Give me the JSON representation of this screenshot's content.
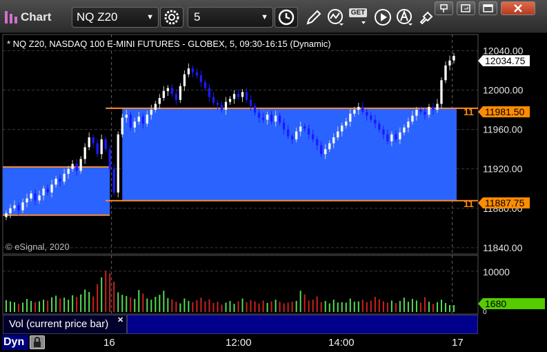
{
  "app": {
    "window_title": "Chart"
  },
  "toolbar": {
    "symbol_value": "NQ Z20",
    "interval_value": "5",
    "get_label": "GET"
  },
  "chart": {
    "header_text": "* NQ Z20, NASDAQ 100 E-MINI FUTURES - GLOBEX, 5, 09:30-16:15 (Dynamic)",
    "copyright": "© eSignal, 2020",
    "price_axis_labels": [
      "12040.00",
      "12000.00",
      "11960.00",
      "11920.00",
      "11880.00",
      "11840.00"
    ],
    "last_price_tag": "12034.75",
    "level_high_tag": "11981.50",
    "level_low_tag": "11887.75",
    "level_high_clip": "11",
    "level_low_clip": "11",
    "colors": {
      "up": "#ffffff",
      "down": "#1a1aff",
      "band": "#2b63ff",
      "level_line": "#ff8c2a",
      "level_tag": "#ff8c00",
      "vol_up": "#55dd55",
      "vol_down": "#cc2222",
      "vol_tag": "#55cc00"
    }
  },
  "volume": {
    "label": "Vol (current price bar)",
    "axis_top_label": "10000",
    "axis_zero_label": "0",
    "last_value_tag": "1680"
  },
  "time_axis": {
    "labels": [
      "16",
      "12:00",
      "14:00",
      "17"
    ]
  },
  "status": {
    "mode_label": "Dyn"
  },
  "chart_data": {
    "type": "candlestick",
    "title": "* NQ Z20, NASDAQ 100 E-MINI FUTURES - GLOBEX, 5, 09:30-16:15 (Dynamic)",
    "ylim": [
      11835,
      12055
    ],
    "levels": [
      11981.5,
      11887.75
    ],
    "last": 12034.75,
    "x": [
      "16",
      "12:00",
      "14:00",
      "17"
    ],
    "values": [
      11875,
      11880,
      11883,
      11878,
      11886,
      11890,
      11895,
      11888,
      11893,
      11900,
      11896,
      11904,
      11910,
      11907,
      11915,
      11920,
      11925,
      11918,
      11930,
      11942,
      11952,
      11946,
      11935,
      11950,
      11940,
      11920,
      11896,
      11955,
      11972,
      11975,
      11962,
      11968,
      11973,
      11966,
      11975,
      11980,
      11986,
      11992,
      11999,
      12002,
      11996,
      11990,
      12004,
      12016,
      12022,
      12018,
      12015,
      12008,
      12002,
      11993,
      11987,
      11985,
      11980,
      11988,
      11991,
      11996,
      11993,
      11998,
      11990,
      11984,
      11977,
      11972,
      11970,
      11975,
      11968,
      11974,
      11967,
      11960,
      11953,
      11950,
      11958,
      11963,
      11961,
      11955,
      11950,
      11944,
      11935,
      11940,
      11946,
      11952,
      11958,
      11964,
      11968,
      11976,
      11980,
      11983,
      11978,
      11974,
      11970,
      11966,
      11960,
      11955,
      11948,
      11955,
      11950,
      11957,
      11962,
      11968,
      11974,
      11980,
      11978,
      11975,
      11983,
      11980,
      11986,
      12010,
      12025,
      12030,
      12034.75
    ],
    "volume": [
      2900,
      2600,
      2400,
      2000,
      2300,
      3200,
      2700,
      2400,
      2600,
      3000,
      2800,
      3600,
      4000,
      3300,
      3500,
      3000,
      4100,
      3700,
      4300,
      5500,
      4900,
      3800,
      6800,
      8500,
      10100,
      9500,
      7400,
      4800,
      4200,
      3900,
      3600,
      3200,
      5400,
      4500,
      3300,
      3000,
      3700,
      4200,
      5200,
      3400,
      3100,
      2500,
      2100,
      3300,
      2700,
      2400,
      2900,
      3500,
      2600,
      3100,
      2200,
      2500,
      1800,
      2300,
      2700,
      2000,
      2600,
      3300,
      2400,
      2900,
      2600,
      2100,
      2800,
      2200,
      2600,
      3000,
      2500,
      2100,
      2300,
      2500,
      2700,
      5200,
      4300,
      2800,
      3000,
      3800,
      2400,
      2700,
      2100,
      3000,
      2300,
      2400,
      2300,
      3300,
      2500,
      2600,
      3000,
      2400,
      2800,
      3700,
      3100,
      2600,
      2300,
      2800,
      2200,
      2700,
      3500,
      2500,
      3200,
      2800,
      2300,
      3600,
      2500,
      2000,
      2400,
      3000,
      2200,
      1700,
      1680
    ],
    "ylabel": "",
    "xlabel": ""
  }
}
